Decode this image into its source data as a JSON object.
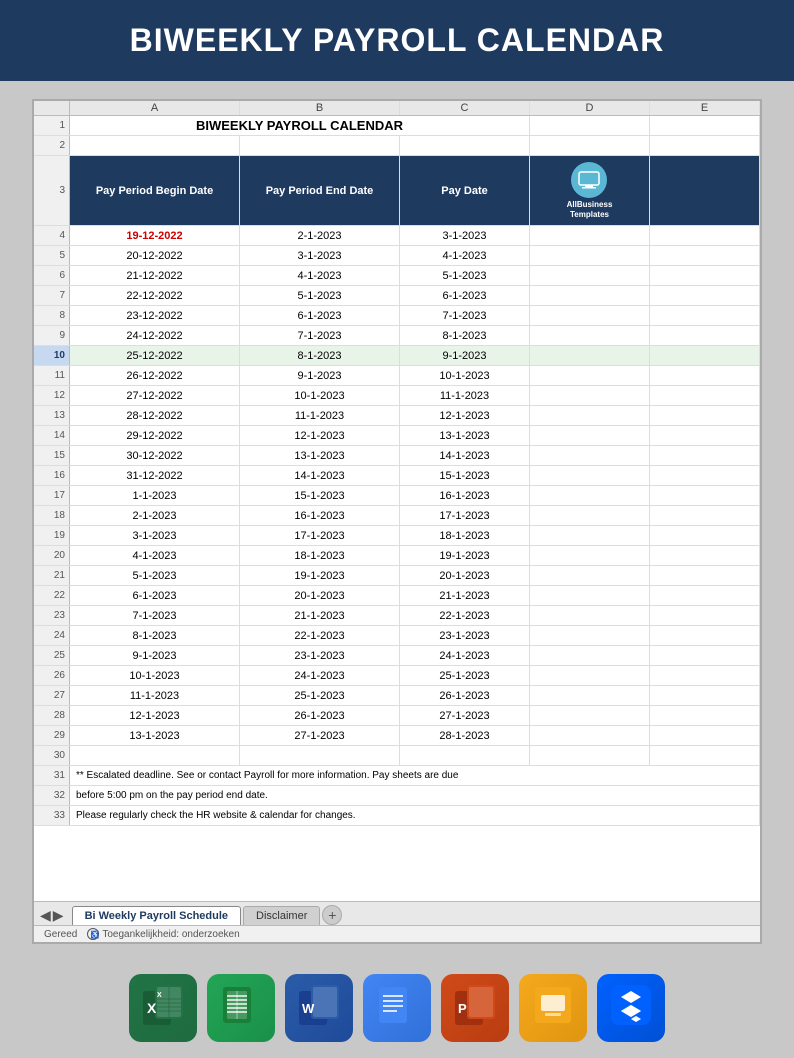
{
  "header": {
    "title": "BIWEEKLY PAYROLL CALENDAR"
  },
  "spreadsheet": {
    "col_headers": [
      "",
      "A",
      "B",
      "C",
      "D",
      "E"
    ],
    "title_row1": "BIWEEKLY PAYROLL CALENDAR",
    "table_headers": {
      "col_a": "Pay Period Begin Date",
      "col_b": "Pay Period End Date",
      "col_c": "Pay Date"
    },
    "logo_text": "AllBusiness Templates",
    "rows": [
      {
        "row": 4,
        "col_a": "19-12-2022",
        "col_b": "2-1-2023",
        "col_c": "3-1-2023",
        "red": true
      },
      {
        "row": 5,
        "col_a": "20-12-2022",
        "col_b": "3-1-2023",
        "col_c": "4-1-2023"
      },
      {
        "row": 6,
        "col_a": "21-12-2022",
        "col_b": "4-1-2023",
        "col_c": "5-1-2023"
      },
      {
        "row": 7,
        "col_a": "22-12-2022",
        "col_b": "5-1-2023",
        "col_c": "6-1-2023"
      },
      {
        "row": 8,
        "col_a": "23-12-2022",
        "col_b": "6-1-2023",
        "col_c": "7-1-2023"
      },
      {
        "row": 9,
        "col_a": "24-12-2022",
        "col_b": "7-1-2023",
        "col_c": "8-1-2023"
      },
      {
        "row": 10,
        "col_a": "25-12-2022",
        "col_b": "8-1-2023",
        "col_c": "9-1-2023",
        "highlight": true
      },
      {
        "row": 11,
        "col_a": "26-12-2022",
        "col_b": "9-1-2023",
        "col_c": "10-1-2023"
      },
      {
        "row": 12,
        "col_a": "27-12-2022",
        "col_b": "10-1-2023",
        "col_c": "11-1-2023"
      },
      {
        "row": 13,
        "col_a": "28-12-2022",
        "col_b": "11-1-2023",
        "col_c": "12-1-2023"
      },
      {
        "row": 14,
        "col_a": "29-12-2022",
        "col_b": "12-1-2023",
        "col_c": "13-1-2023"
      },
      {
        "row": 15,
        "col_a": "30-12-2022",
        "col_b": "13-1-2023",
        "col_c": "14-1-2023"
      },
      {
        "row": 16,
        "col_a": "31-12-2022",
        "col_b": "14-1-2023",
        "col_c": "15-1-2023"
      },
      {
        "row": 17,
        "col_a": "1-1-2023",
        "col_b": "15-1-2023",
        "col_c": "16-1-2023"
      },
      {
        "row": 18,
        "col_a": "2-1-2023",
        "col_b": "16-1-2023",
        "col_c": "17-1-2023"
      },
      {
        "row": 19,
        "col_a": "3-1-2023",
        "col_b": "17-1-2023",
        "col_c": "18-1-2023"
      },
      {
        "row": 20,
        "col_a": "4-1-2023",
        "col_b": "18-1-2023",
        "col_c": "19-1-2023"
      },
      {
        "row": 21,
        "col_a": "5-1-2023",
        "col_b": "19-1-2023",
        "col_c": "20-1-2023"
      },
      {
        "row": 22,
        "col_a": "6-1-2023",
        "col_b": "20-1-2023",
        "col_c": "21-1-2023"
      },
      {
        "row": 23,
        "col_a": "7-1-2023",
        "col_b": "21-1-2023",
        "col_c": "22-1-2023"
      },
      {
        "row": 24,
        "col_a": "8-1-2023",
        "col_b": "22-1-2023",
        "col_c": "23-1-2023"
      },
      {
        "row": 25,
        "col_a": "9-1-2023",
        "col_b": "23-1-2023",
        "col_c": "24-1-2023"
      },
      {
        "row": 26,
        "col_a": "10-1-2023",
        "col_b": "24-1-2023",
        "col_c": "25-1-2023"
      },
      {
        "row": 27,
        "col_a": "11-1-2023",
        "col_b": "25-1-2023",
        "col_c": "26-1-2023"
      },
      {
        "row": 28,
        "col_a": "12-1-2023",
        "col_b": "26-1-2023",
        "col_c": "27-1-2023"
      },
      {
        "row": 29,
        "col_a": "13-1-2023",
        "col_b": "27-1-2023",
        "col_c": "28-1-2023"
      }
    ],
    "notes": [
      "** Escalated deadline. See  or contact Payroll for more information. Pay sheets are due",
      "before 5:00 pm on the pay period end date.",
      "Please regularly check the HR website & calendar for changes."
    ],
    "tabs": {
      "active": "Bi Weekly Payroll Schedule",
      "inactive": [
        "Disclaimer"
      ]
    },
    "status_bar": {
      "ready": "Gereed",
      "accessibility": "Toegankelijkheid: onderzoeken"
    }
  },
  "app_icons": [
    {
      "id": "excel",
      "label": "Excel",
      "class": "excel"
    },
    {
      "id": "gsheets",
      "label": "Google Sheets",
      "class": "gsheets"
    },
    {
      "id": "word",
      "label": "Word",
      "class": "word"
    },
    {
      "id": "gdocs",
      "label": "Google Docs",
      "class": "gdocs"
    },
    {
      "id": "ppt",
      "label": "PowerPoint",
      "class": "ppt"
    },
    {
      "id": "gslides",
      "label": "Google Slides",
      "class": "gslides"
    },
    {
      "id": "dropbox",
      "label": "Dropbox",
      "class": "dropbox"
    }
  ]
}
